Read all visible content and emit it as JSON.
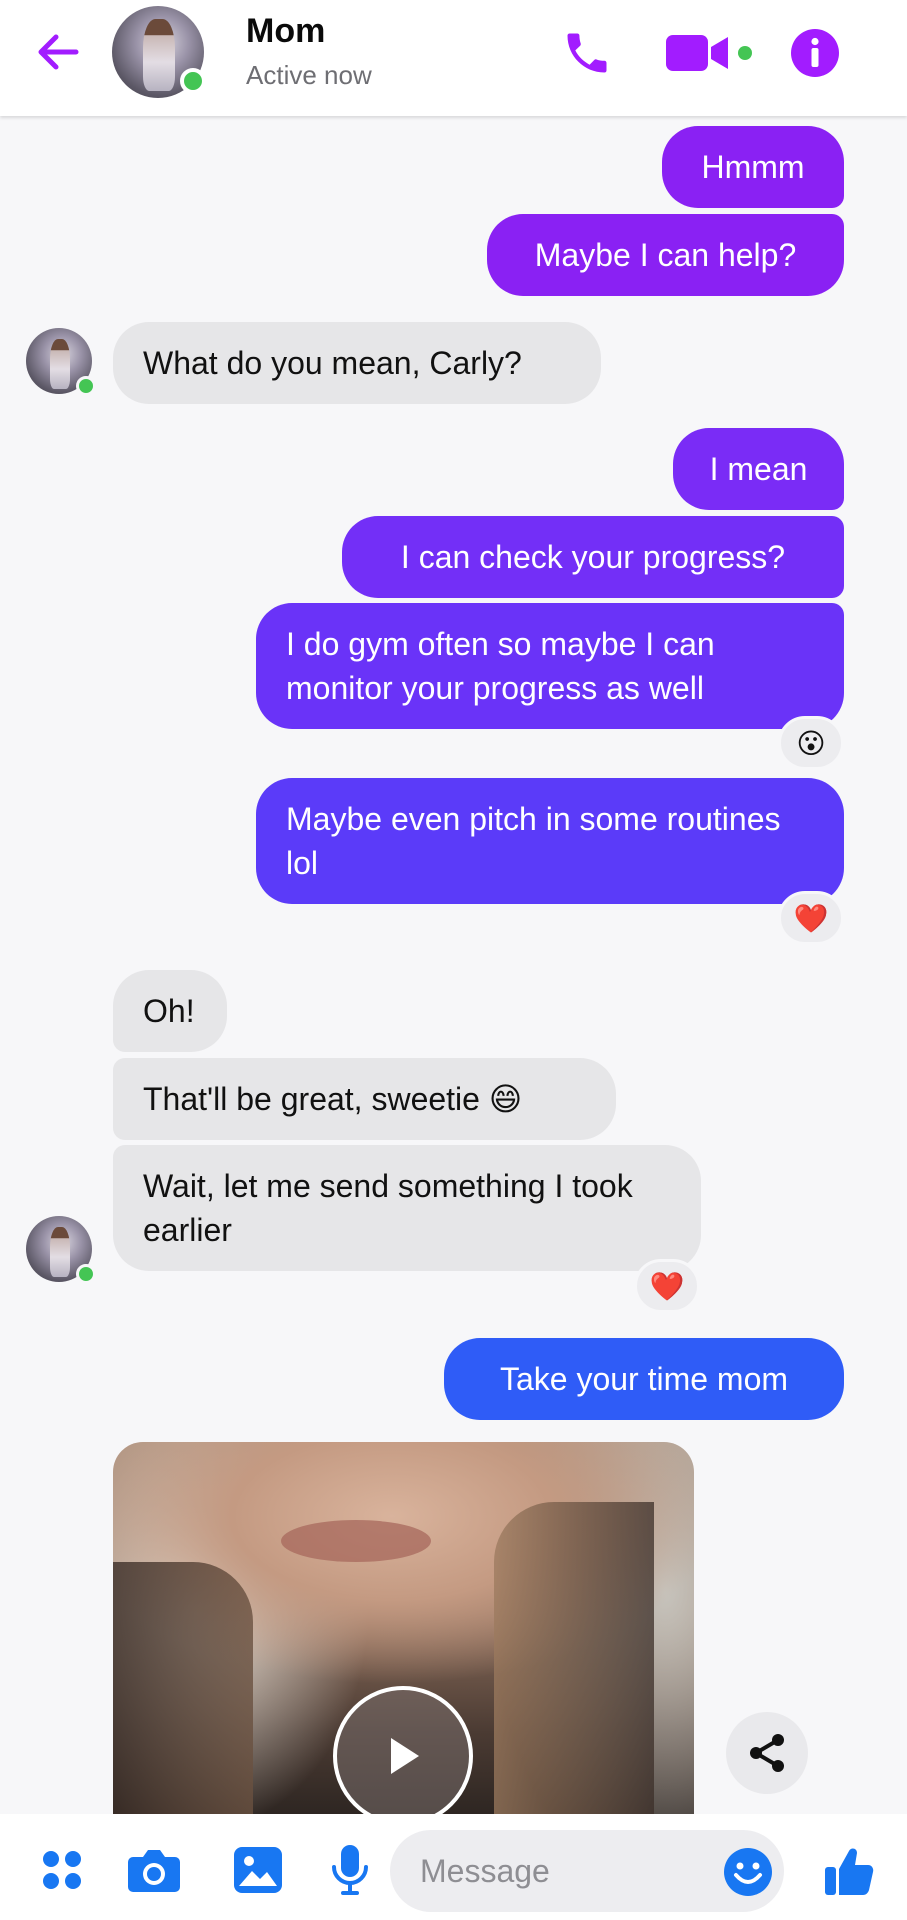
{
  "header": {
    "contact_name": "Mom",
    "status": "Active now",
    "icons": [
      "back-arrow-icon",
      "phone-icon",
      "video-camera-icon",
      "info-icon"
    ],
    "accent": "#a21cff",
    "online_color": "#44c554"
  },
  "messages": [
    {
      "from": "me",
      "text": "Hmmm",
      "color": "#8a21f3"
    },
    {
      "from": "me",
      "text": "Maybe I can help?",
      "color": "#8a21f3"
    },
    {
      "from": "mom",
      "text": "What do you mean, Carly?"
    },
    {
      "from": "me",
      "text": "I mean",
      "color": "#7a2cf6"
    },
    {
      "from": "me",
      "text": "I can check your progress?",
      "color": "#732ff7"
    },
    {
      "from": "me",
      "text": "I do gym often so maybe I can monitor your progress as well",
      "color": "#6a33f8",
      "reaction": "😮"
    },
    {
      "from": "me",
      "text": "Maybe even pitch in some routines lol",
      "color": "#5b3bf9",
      "reaction": "❤️"
    },
    {
      "from": "mom",
      "text": "Oh!"
    },
    {
      "from": "mom",
      "text": "That'll be great, sweetie 😄"
    },
    {
      "from": "mom",
      "text": "Wait, let me send something I took earlier",
      "reaction": "❤️"
    },
    {
      "from": "me",
      "text": "Take your time mom",
      "color": "#2f5cf7"
    },
    {
      "from": "mom",
      "type": "video",
      "icons": [
        "play-icon",
        "share-icon"
      ]
    }
  ],
  "composer": {
    "placeholder": "Message",
    "icons": [
      "menu-dots-icon",
      "camera-icon",
      "gallery-icon",
      "microphone-icon",
      "emoji-icon",
      "thumbs-up-icon"
    ],
    "accent": "#1877f2"
  }
}
